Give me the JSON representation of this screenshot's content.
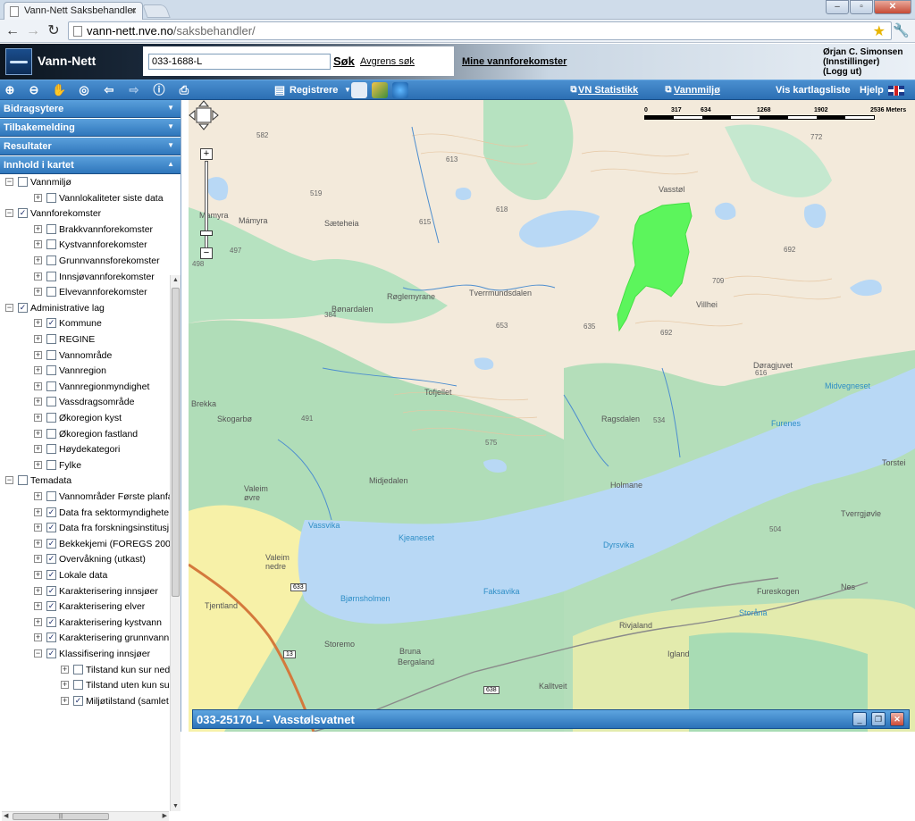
{
  "browser": {
    "tab_title": "Vann-Nett Saksbehandler",
    "url_host": "vann-nett.nve.no",
    "url_path": "/saksbehandler/"
  },
  "header": {
    "brand": "Vann-Nett",
    "search_value": "033-1688-L",
    "search_button": "Søk",
    "refine_link": "Avgrens søk",
    "my_waterbodies": "Mine vannforekomster",
    "user_name": "Ørjan C. Simonsen",
    "settings_link": "(Innstillinger)",
    "logout_link": "(Logg ut)"
  },
  "toolbar": {
    "register_label": "Registrere",
    "stats_link": "VN Statistikk",
    "vannmiljo_link": "Vannmiljø",
    "layerlist_label": "Vis kartlagsliste",
    "help_label": "Hjelp"
  },
  "sidebar": {
    "panels": [
      "Bidragsytere",
      "Tilbakemelding",
      "Resultater",
      "Innhold i kartet"
    ],
    "tree": [
      {
        "label": "Vannmiljø",
        "level": 0,
        "expander": "−",
        "checked": false
      },
      {
        "label": "Vannlokaliteter siste data",
        "level": 1,
        "expander": "+",
        "checked": false
      },
      {
        "label": "Vannforekomster",
        "level": 0,
        "expander": "−",
        "checked": true
      },
      {
        "label": "Brakkvannforekomster",
        "level": 1,
        "expander": "+",
        "checked": false
      },
      {
        "label": "Kystvannforekomster",
        "level": 1,
        "expander": "+",
        "checked": false
      },
      {
        "label": "Grunnvannsforekomster",
        "level": 1,
        "expander": "+",
        "checked": false
      },
      {
        "label": "Innsjøvannforekomster",
        "level": 1,
        "expander": "+",
        "checked": false
      },
      {
        "label": "Elvevannforekomster",
        "level": 1,
        "expander": "+",
        "checked": false
      },
      {
        "label": "Administrative lag",
        "level": 0,
        "expander": "−",
        "checked": true
      },
      {
        "label": "Kommune",
        "level": 1,
        "expander": "+",
        "checked": true
      },
      {
        "label": "REGINE",
        "level": 1,
        "expander": "+",
        "checked": false
      },
      {
        "label": "Vannområde",
        "level": 1,
        "expander": "+",
        "checked": false
      },
      {
        "label": "Vannregion",
        "level": 1,
        "expander": "+",
        "checked": false
      },
      {
        "label": "Vannregionmyndighet",
        "level": 1,
        "expander": "+",
        "checked": false
      },
      {
        "label": "Vassdragsområde",
        "level": 1,
        "expander": "+",
        "checked": false
      },
      {
        "label": "Økoregion kyst",
        "level": 1,
        "expander": "+",
        "checked": false
      },
      {
        "label": "Økoregion fastland",
        "level": 1,
        "expander": "+",
        "checked": false
      },
      {
        "label": "Høydekategori",
        "level": 1,
        "expander": "+",
        "checked": false
      },
      {
        "label": "Fylke",
        "level": 1,
        "expander": "+",
        "checked": false
      },
      {
        "label": "Temadata",
        "level": 0,
        "expander": "−",
        "checked": false
      },
      {
        "label": "Vannområder Første planfa",
        "level": 1,
        "expander": "+",
        "checked": false
      },
      {
        "label": "Data fra sektormyndighete",
        "level": 1,
        "expander": "+",
        "checked": true
      },
      {
        "label": "Data fra forskningsinstitusj",
        "level": 1,
        "expander": "+",
        "checked": true
      },
      {
        "label": "Bekkekjemi (FOREGS 2008",
        "level": 1,
        "expander": "+",
        "checked": true
      },
      {
        "label": "Overvåkning (utkast)",
        "level": 1,
        "expander": "+",
        "checked": true
      },
      {
        "label": "Lokale data",
        "level": 1,
        "expander": "+",
        "checked": true
      },
      {
        "label": "Karakterisering innsjøer",
        "level": 1,
        "expander": "+",
        "checked": true
      },
      {
        "label": "Karakterisering elver",
        "level": 1,
        "expander": "+",
        "checked": true
      },
      {
        "label": "Karakterisering kystvann",
        "level": 1,
        "expander": "+",
        "checked": true
      },
      {
        "label": "Karakterisering grunnvann",
        "level": 1,
        "expander": "+",
        "checked": true
      },
      {
        "label": "Klassifisering innsjøer",
        "level": 1,
        "expander": "−",
        "checked": true
      },
      {
        "label": "Tilstand kun sur ned",
        "level": 2,
        "expander": "+",
        "checked": false
      },
      {
        "label": "Tilstand uten kun su",
        "level": 2,
        "expander": "+",
        "checked": false
      },
      {
        "label": "Miljøtilstand (samlet",
        "level": 2,
        "expander": "+",
        "checked": true
      }
    ]
  },
  "map": {
    "scale_labels": [
      "0",
      "317",
      "634",
      "1268",
      "1902",
      "2536 Meters"
    ],
    "places": [
      {
        "t": "Mamyra",
        "k": "place"
      },
      {
        "t": "Mámyra",
        "k": "place"
      },
      {
        "t": "Sæteheia",
        "k": "place"
      },
      {
        "t": "Røglemyrane",
        "k": "place"
      },
      {
        "t": "Bønardalen",
        "k": "place"
      },
      {
        "t": "Tverrmundsdalen",
        "k": "place"
      },
      {
        "t": "Vasstøl",
        "k": "place"
      },
      {
        "t": "Villhei",
        "k": "place"
      },
      {
        "t": "Døragjuvet",
        "k": "place"
      },
      {
        "t": "Midvegneset",
        "k": "water"
      },
      {
        "t": "Furenes",
        "k": "water"
      },
      {
        "t": "Tofjellet",
        "k": "place"
      },
      {
        "t": "Ragsdalen",
        "k": "place"
      },
      {
        "t": "Brekka",
        "k": "place"
      },
      {
        "t": "Skogarbø",
        "k": "place"
      },
      {
        "t": "Midjedalen",
        "k": "place"
      },
      {
        "t": "Holmane",
        "k": "place"
      },
      {
        "t": "Valeim øvre",
        "k": "place"
      },
      {
        "t": "Vassvika",
        "k": "water"
      },
      {
        "t": "Kjeaneset",
        "k": "water"
      },
      {
        "t": "Dyrsvika",
        "k": "water"
      },
      {
        "t": "Valeim nedre",
        "k": "place"
      },
      {
        "t": "Faksavika",
        "k": "water"
      },
      {
        "t": "Bjørnsholmen",
        "k": "water"
      },
      {
        "t": "Tjentland",
        "k": "place"
      },
      {
        "t": "Storemo",
        "k": "place"
      },
      {
        "t": "Bruna",
        "k": "place"
      },
      {
        "t": "Bergaland",
        "k": "place"
      },
      {
        "t": "Rivjaland",
        "k": "place"
      },
      {
        "t": "Igland",
        "k": "place"
      },
      {
        "t": "Kalltveit",
        "k": "place"
      },
      {
        "t": "Fureskogen",
        "k": "place"
      },
      {
        "t": "Storåna",
        "k": "water"
      },
      {
        "t": "Nes",
        "k": "place"
      },
      {
        "t": "Tverrgjøvle",
        "k": "place"
      },
      {
        "t": "Torstei",
        "k": "place"
      }
    ],
    "heights": [
      "582",
      "613",
      "618",
      "615",
      "519",
      "498",
      "497",
      "384",
      "653",
      "635",
      "692",
      "709",
      "692",
      "616",
      "772",
      "491",
      "575",
      "534",
      "504"
    ],
    "road_numbers": [
      "633",
      "13",
      "638"
    ]
  },
  "infobar": {
    "title": "033-25170-L - Vasstølsvatnet"
  },
  "colors": {
    "accent": "#2f76bb",
    "selected_waterbody": "#5cf55c",
    "water": "#b8d8f5"
  }
}
